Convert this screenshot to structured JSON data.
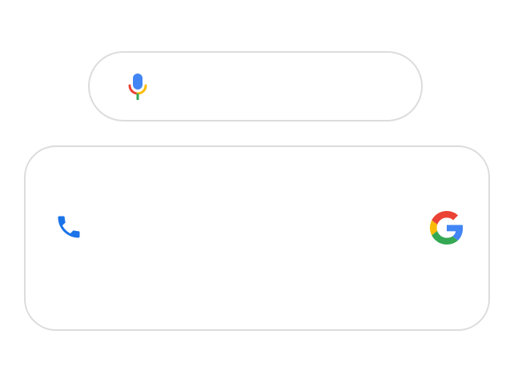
{
  "voice_search": {
    "icon": "microphone-icon",
    "colors": {
      "capsule": "#4285F4",
      "arc_left": "#EA4335",
      "arc_right": "#FBBC05",
      "stem": "#34A853"
    }
  },
  "shortcut_card": {
    "left_icon": "phone-icon",
    "left_icon_color": "#1A73E8",
    "right_icon": "google-g-icon",
    "google_colors": {
      "red": "#EA4335",
      "yellow": "#FBBC05",
      "green": "#34A853",
      "blue": "#4285F4"
    }
  },
  "theme": {
    "border": "#dcdcdc",
    "background": "#ffffff"
  }
}
